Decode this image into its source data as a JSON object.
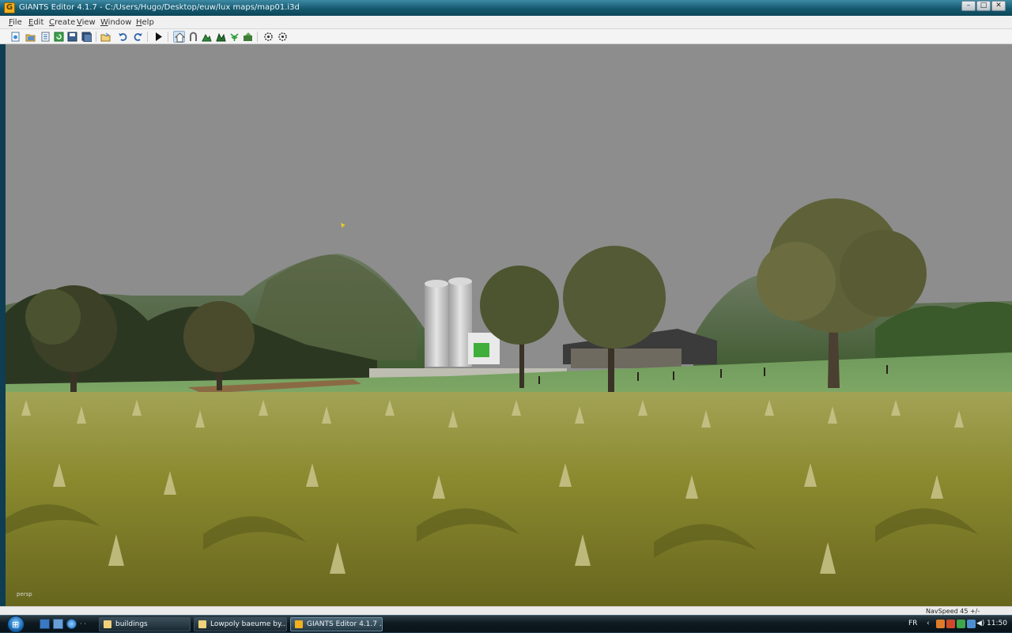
{
  "window": {
    "title": "GIANTS Editor 4.1.7 - C:/Users/Hugo/Desktop/euw/lux maps/map01.i3d",
    "app_icon_letter": "G",
    "controls": {
      "minimize": "–",
      "maximize": "□",
      "close": "✕"
    }
  },
  "menu": {
    "items": [
      "File",
      "Edit",
      "Create",
      "View",
      "Window",
      "Help"
    ]
  },
  "toolbar": {
    "icons": [
      "new-file-icon",
      "open-file-icon",
      "properties-icon",
      "refresh-icon",
      "save-icon",
      "save-all-icon",
      "open-folder-icon",
      "undo-icon",
      "redo-icon",
      "play-icon",
      "select-mode-icon",
      "move-mode-icon",
      "terrain-sculpt-icon",
      "terrain-paint-icon",
      "foliage-paint-icon",
      "decal-paint-icon",
      "settings-gear-icon",
      "settings-gear-2-icon"
    ]
  },
  "viewport": {
    "camera_label": "persp"
  },
  "statusbar": {
    "nav_speed": "NavSpeed 45 +/-"
  },
  "taskbar": {
    "start_glyph": "⊞",
    "tasks": [
      {
        "label": "buildings",
        "active": false
      },
      {
        "label": "Lowpoly baeume by...",
        "active": false
      },
      {
        "label": "GIANTS Editor 4.1.7 ...",
        "active": true
      }
    ],
    "language": "FR",
    "clock": "11:50"
  },
  "colors": {
    "titlebar": "#15596f",
    "sky": "#8d8d8d",
    "corn": "#8a8a2a",
    "hill": "#4f6b3a",
    "taskbar": "#0f1a20"
  }
}
